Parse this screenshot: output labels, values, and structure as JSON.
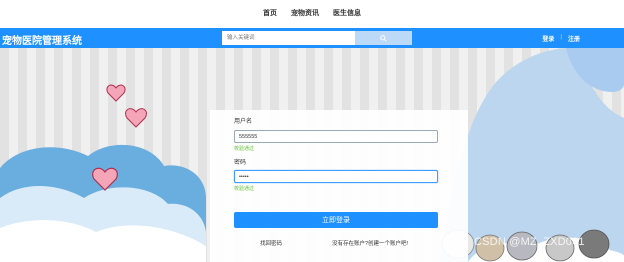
{
  "top_nav": {
    "items": [
      "首页",
      "宠物资讯",
      "医生信息"
    ]
  },
  "header": {
    "brand": "宠物医院管理系统",
    "search_placeholder": "输入关键词",
    "login_link": "登录",
    "separator": "|",
    "register_link": "注册"
  },
  "login_form": {
    "username_label": "用户名",
    "username_value": "555555",
    "username_valid": "校验通过",
    "password_label": "密码",
    "password_value": "•••••",
    "password_valid": "校验通过",
    "submit_label": "立即登录",
    "forgot_link": "找回密码",
    "register_prompt": "没有存在账户?创建一个账户吧!"
  },
  "watermark": "CSDN @MZ_ZXD001",
  "colors": {
    "header": "#1e90ff",
    "accent": "#1e90ff",
    "valid": "#67c23a",
    "cloud": "#6aaee0",
    "heart": "#f08aa0"
  },
  "icons": [
    "search-icon",
    "heart-icon",
    "cloud-decoration",
    "cat-illustration"
  ]
}
